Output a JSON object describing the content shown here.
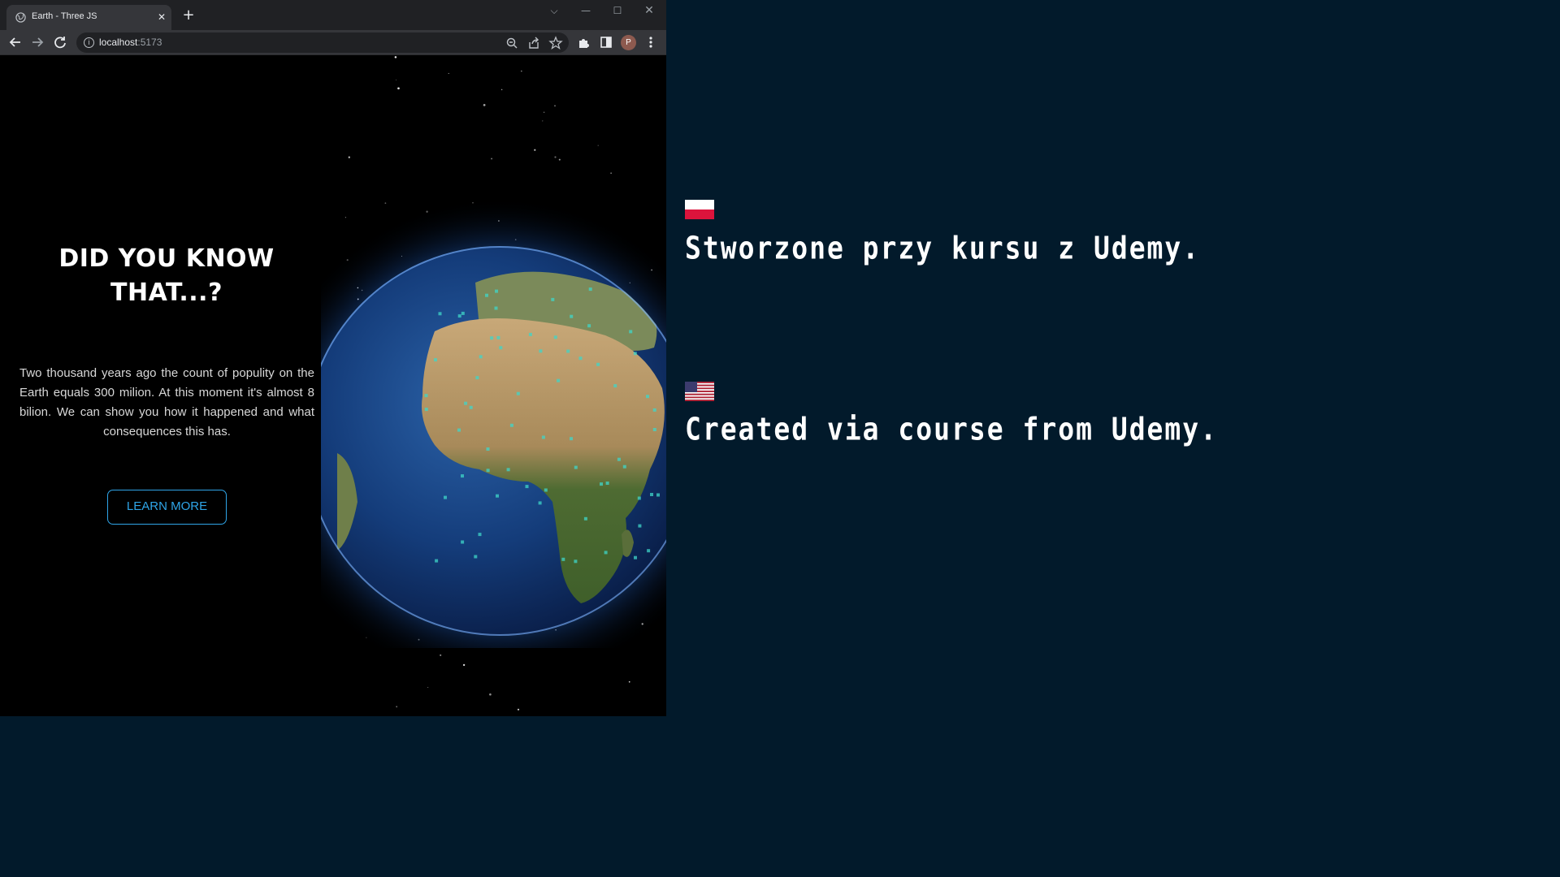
{
  "browser": {
    "tab_title": "Earth - Three JS",
    "url_host": "localhost",
    "url_port": ":5173",
    "profile_initial": "P",
    "icons": [
      "globe-icon",
      "close-icon",
      "plus-icon",
      "chevron-down-icon",
      "minimize-icon",
      "maximize-icon",
      "close-window-icon",
      "back-arrow-icon",
      "forward-arrow-icon",
      "reload-icon",
      "info-icon",
      "zoom-icon",
      "share-icon",
      "star-icon",
      "extensions-icon",
      "side-panel-icon",
      "menu-icon"
    ]
  },
  "page": {
    "heading_line1": "DID YOU KNOW",
    "heading_line2": "THAT...?",
    "body": "Two thousand years ago the count of populity on the Earth equals 300 milion. At this moment it's almost 8 bilion. We can show you how it happened and what consequences this has.",
    "button_label": "LEARN MORE",
    "accent_color": "#2fa5e8"
  },
  "captions": {
    "polish": "Stworzone przy kursu z Udemy.",
    "english": "Created via course from Udemy."
  },
  "colors": {
    "panel_background": "#021a2b",
    "page_background": "#000000"
  }
}
